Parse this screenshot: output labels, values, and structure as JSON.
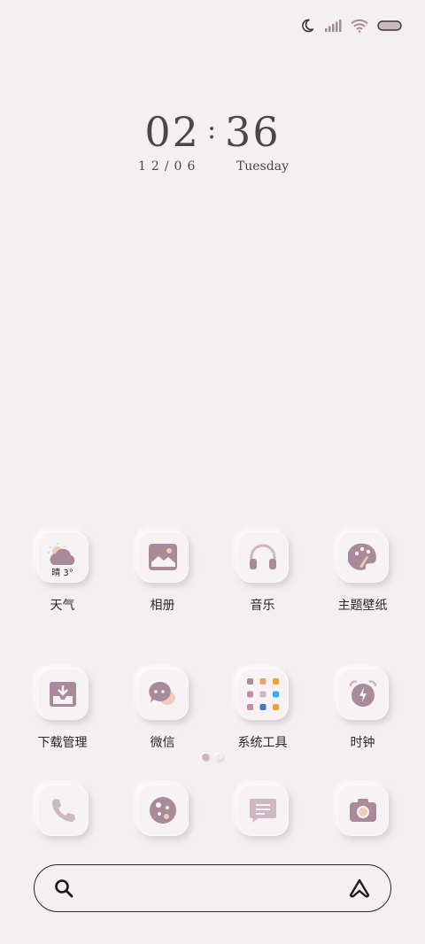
{
  "status_bar": {
    "icons": [
      "moon-icon",
      "signal-icon",
      "wifi-icon",
      "battery-icon"
    ]
  },
  "clock": {
    "hour": "02",
    "separator": ":",
    "minute": "36",
    "date": "12/06",
    "weekday": "Tuesday"
  },
  "apps": {
    "weather": {
      "label": "天气",
      "temp": "晴 3°"
    },
    "gallery": {
      "label": "相册"
    },
    "music": {
      "label": "音乐"
    },
    "themes": {
      "label": "主题壁纸"
    },
    "downloads": {
      "label": "下载管理"
    },
    "wechat": {
      "label": "微信"
    },
    "tools": {
      "label": "系统工具"
    },
    "clock": {
      "label": "时钟"
    }
  },
  "pager": {
    "pages": 2,
    "active": 1
  },
  "dock": {
    "icons": [
      "phone-icon",
      "browser-icon",
      "messages-icon",
      "camera-icon"
    ]
  },
  "colors": {
    "background": "#f4f0f1",
    "accent": "#a88a9a",
    "accent_light": "#cdb7c2",
    "peach": "#f0cdb9",
    "text": "#2a2728"
  }
}
